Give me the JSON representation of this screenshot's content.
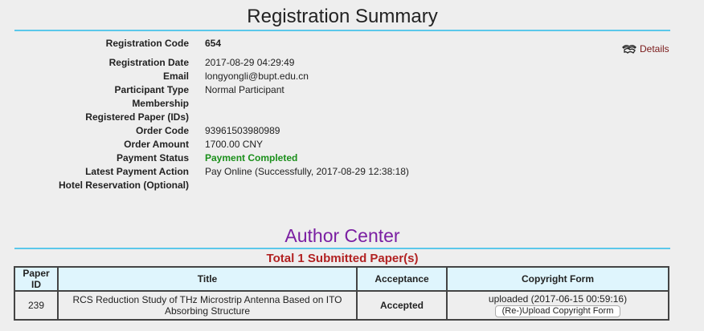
{
  "registration": {
    "title": "Registration Summary",
    "details_label": "Details",
    "fields": [
      {
        "label": "Registration Code",
        "value": "654"
      },
      {
        "label": "Registration Date",
        "value": "2017-08-29 04:29:49"
      },
      {
        "label": "Email",
        "value": "longyongli@bupt.edu.cn"
      },
      {
        "label": "Participant Type",
        "value": "Normal Participant"
      },
      {
        "label": "Membership",
        "value": ""
      },
      {
        "label": "Registered Paper (IDs)",
        "value": ""
      },
      {
        "label": "Order Code",
        "value": "93961503980989"
      },
      {
        "label": "Order Amount",
        "value": "1700.00 CNY"
      },
      {
        "label": "Payment Status",
        "value": "Payment Completed"
      },
      {
        "label": "Latest Payment Action",
        "value": "Pay Online (Successfully, 2017-08-29 12:38:18)"
      },
      {
        "label": "Hotel Reservation (Optional)",
        "value": ""
      }
    ]
  },
  "author_center": {
    "title": "Author Center",
    "total_label": "Total 1 Submitted Paper(s)",
    "columns": [
      "Paper ID",
      "Title",
      "Acceptance",
      "Copyright Form"
    ],
    "rows": [
      {
        "paper_id": "239",
        "title": "RCS Reduction Study of THz Microstrip Antenna Based on ITO Absorbing Structure",
        "acceptance": "Accepted",
        "copyright_status": "uploaded (2017-06-15 00:59:16)",
        "upload_button": "(Re-)Upload Copyright Form"
      }
    ]
  },
  "colors": {
    "rule": "#5bc8ea",
    "author_title": "#7b1fa2",
    "total": "#b22222",
    "success": "#1a8f1a",
    "details_link": "#7a1a1a",
    "table_header_bg": "#dff5fd"
  },
  "icons": {
    "details": "details-icon"
  }
}
